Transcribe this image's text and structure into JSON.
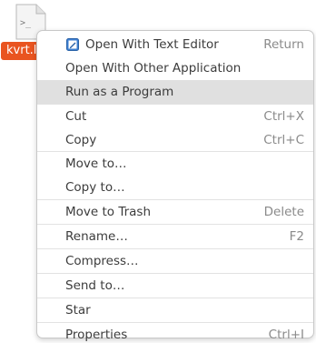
{
  "file": {
    "icon": "terminal-script-icon",
    "icon_glyph": ">_",
    "name": "kvrt.l"
  },
  "menu": {
    "items": [
      {
        "label": "Open With Text Editor",
        "accel": "Return",
        "icon": "text-editor-icon"
      },
      {
        "label": "Open With Other Application",
        "accel": ""
      },
      {
        "label": "Run as a Program",
        "accel": ""
      },
      {
        "label": "Cut",
        "accel": "Ctrl+X"
      },
      {
        "label": "Copy",
        "accel": "Ctrl+C"
      },
      {
        "label": "Move to…",
        "accel": ""
      },
      {
        "label": "Copy to…",
        "accel": ""
      },
      {
        "label": "Move to Trash",
        "accel": "Delete"
      },
      {
        "label": "Rename…",
        "accel": "F2"
      },
      {
        "label": "Compress…",
        "accel": ""
      },
      {
        "label": "Send to…",
        "accel": ""
      },
      {
        "label": "Star",
        "accel": ""
      },
      {
        "label": "Properties",
        "accel": "Ctrl+I"
      }
    ]
  },
  "colors": {
    "accent": "#e95420",
    "highlight": "#e0e0e0"
  }
}
